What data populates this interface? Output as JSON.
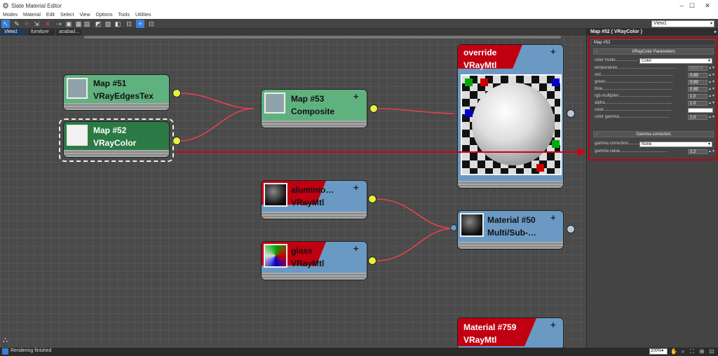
{
  "window": {
    "title": "Slate Material Editor",
    "minimize": "–",
    "maximize": "☐",
    "close": "✕"
  },
  "menu": [
    "Modes",
    "Material",
    "Edit",
    "Select",
    "View",
    "Options",
    "Tools",
    "Utilities"
  ],
  "toolbar": {
    "icons": [
      "select-icon",
      "eyedropper-icon",
      "pick-icon",
      "assign-icon",
      "delete-icon",
      "move-children-icon",
      "hide-icon",
      "layout-icon",
      "layout-children-icon",
      "show-map-icon",
      "show-background-icon",
      "show-end-result-icon",
      "material-map-navigator-icon",
      "highlight-icon"
    ],
    "glyphs": [
      "↖",
      "✎",
      "⁘",
      "⇲",
      "✕",
      "⇢",
      "▣",
      "▦",
      "▤",
      "◩",
      "▨",
      "◧",
      "⊡",
      "⌖"
    ]
  },
  "view_selector": {
    "value": "View1",
    "arrow": "▾"
  },
  "tabs": [
    "View1",
    "furniture",
    "acabad…"
  ],
  "nodes": {
    "map51": {
      "line1": "Map #51",
      "line2": "VRayEdgesTex"
    },
    "map52": {
      "line1": "Map #52",
      "line2": "VRayColor"
    },
    "map53": {
      "line1": "Map #53",
      "line2": "Composite",
      "plus": "+"
    },
    "override": {
      "line1": "override",
      "line2": "VRayMtl",
      "plus": "+"
    },
    "aluminio": {
      "line1": "aluminio…",
      "line2": "VRayMtl",
      "plus": "+"
    },
    "glass": {
      "line1": "glass",
      "line2": "VRayMtl",
      "plus": "+"
    },
    "material50": {
      "line1": "Material #50",
      "line2": "Multi/Sub-…",
      "plus": "+"
    },
    "material759": {
      "line1": "Material #759",
      "line2": "VRayMtl",
      "plus": "+"
    }
  },
  "right_panel": {
    "header": "Map #52  ( VRayColor )",
    "header_arrow": "▸",
    "map_name": "Map #52",
    "rollout1": {
      "title": "VRayColor Parameters",
      "collapse": "-",
      "params": [
        {
          "label": "color mode...................",
          "type": "drop",
          "value": "Color"
        },
        {
          "label": "temperature...................................................",
          "type": "spin",
          "value": "6500.0"
        },
        {
          "label": "red..............................................................",
          "type": "spin",
          "value": "0.89"
        },
        {
          "label": "green..........................................................",
          "type": "spin",
          "value": "0.89"
        },
        {
          "label": "blue...........................................................",
          "type": "spin",
          "value": "0.89"
        },
        {
          "label": "rgb multiplier.............................................",
          "type": "spin",
          "value": "1.0"
        },
        {
          "label": "alpha..........................................................",
          "type": "spin",
          "value": "1.0"
        },
        {
          "label": "color..........................................................",
          "type": "swatch",
          "value": ""
        },
        {
          "label": "color gamma...........................................",
          "type": "spin",
          "value": "1.0"
        }
      ]
    },
    "rollout2": {
      "title": "Gamma correction",
      "collapse": "-",
      "params": [
        {
          "label": "gamma correction...........",
          "type": "drop",
          "value": "None"
        },
        {
          "label": "gamma value.........................................",
          "type": "spin",
          "value": "2.2"
        }
      ]
    },
    "spinner_arrows": "▲▼",
    "drop_arrow": "▾"
  },
  "status": {
    "text": "Rendering finished",
    "zoom": "200%",
    "zoom_arrow": "▾",
    "icons": [
      "pan-icon",
      "zoom-region-icon",
      "zoom-extents-icon",
      "zoom-selected-icon",
      "fit-icon"
    ],
    "glyphs": [
      "✋",
      "⌕",
      "⛶",
      "⊞",
      "⊡"
    ]
  },
  "canvas_icon_glyph": "⛬",
  "colors": {
    "accent_red": "#c00010",
    "socket_yellow": "#e6f238",
    "wire_red": "#e8404a",
    "node_green": "#5fb27e",
    "node_blue": "#6a9ac4",
    "selected_blue": "#3a7fd5"
  }
}
